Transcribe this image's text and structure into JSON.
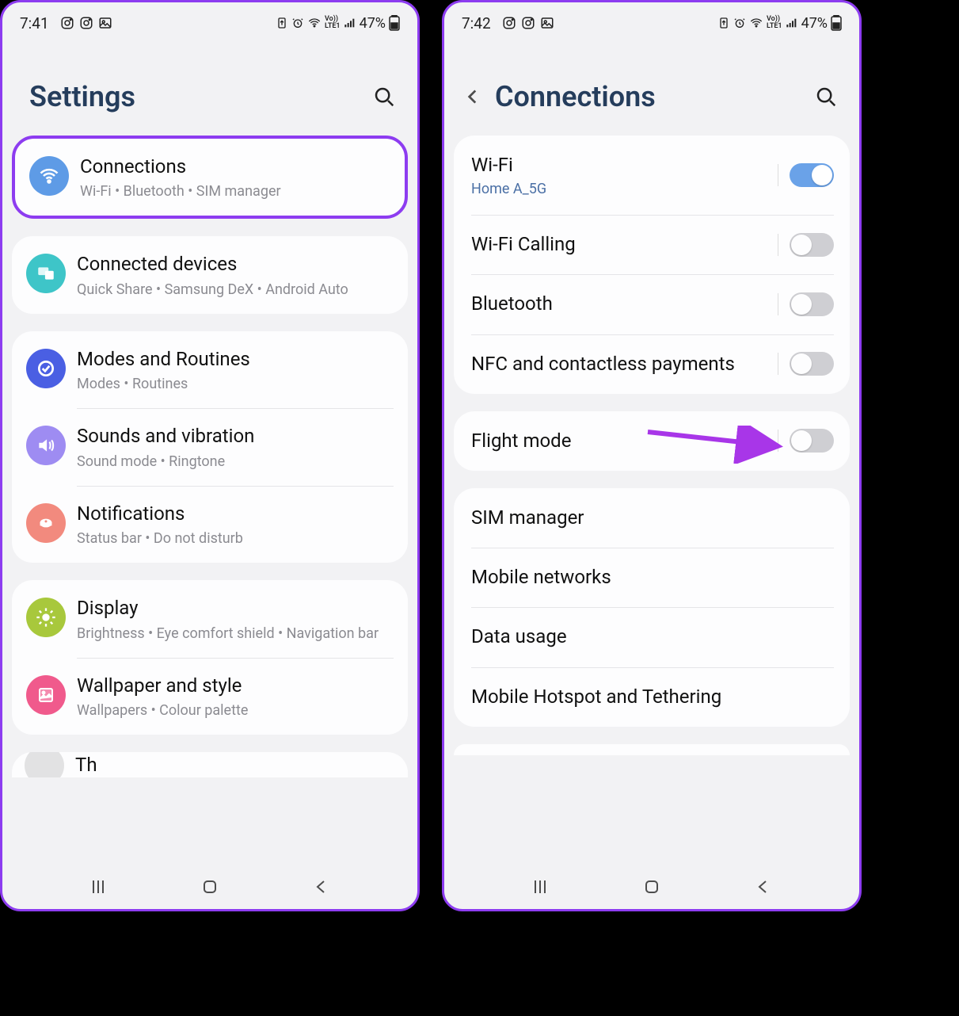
{
  "left": {
    "status": {
      "time": "7:41",
      "battery": "47%",
      "net": "LTE1",
      "vo": "Vo))"
    },
    "title": "Settings",
    "groups": [
      {
        "highlight": true,
        "items": [
          {
            "icon": "wifi",
            "color": "bg-blue",
            "title": "Connections",
            "sub": "Wi-Fi  •  Bluetooth  •  SIM manager"
          }
        ]
      },
      {
        "items": [
          {
            "icon": "devices",
            "color": "bg-teal",
            "title": "Connected devices",
            "sub": "Quick Share  •  Samsung DeX  •  Android Auto"
          }
        ]
      },
      {
        "items": [
          {
            "icon": "modes",
            "color": "bg-indigo",
            "title": "Modes and Routines",
            "sub": "Modes  •  Routines"
          },
          {
            "icon": "sound",
            "color": "bg-lav",
            "title": "Sounds and vibration",
            "sub": "Sound mode  •  Ringtone"
          },
          {
            "icon": "bell",
            "color": "bg-coral",
            "title": "Notifications",
            "sub": "Status bar  •  Do not disturb"
          }
        ]
      },
      {
        "items": [
          {
            "icon": "sun",
            "color": "bg-green",
            "title": "Display",
            "sub": "Brightness  •  Eye comfort shield  •  Navigation bar"
          },
          {
            "icon": "wallpaper",
            "color": "bg-pink",
            "title": "Wallpaper and style",
            "sub": "Wallpapers  •  Colour palette"
          }
        ]
      }
    ],
    "partial_next": "Th"
  },
  "right": {
    "status": {
      "time": "7:42",
      "battery": "47%",
      "net": "LTE1",
      "vo": "Vo))"
    },
    "title": "Connections",
    "groups": [
      {
        "items": [
          {
            "title": "Wi-Fi",
            "sub": "Home A_5G",
            "toggle": true,
            "on": true,
            "div": true
          },
          {
            "title": "Wi-Fi Calling",
            "toggle": true,
            "on": false,
            "div": true
          },
          {
            "title": "Bluetooth",
            "toggle": true,
            "on": false,
            "div": true
          },
          {
            "title": "NFC and contactless payments",
            "toggle": true,
            "on": false,
            "div": true
          }
        ]
      },
      {
        "items": [
          {
            "title": "Flight mode",
            "toggle": true,
            "on": false,
            "div": true,
            "arrow": true
          }
        ]
      },
      {
        "items": [
          {
            "title": "SIM manager"
          },
          {
            "title": "Mobile networks"
          },
          {
            "title": "Data usage"
          },
          {
            "title": "Mobile Hotspot and Tethering"
          }
        ]
      }
    ]
  }
}
